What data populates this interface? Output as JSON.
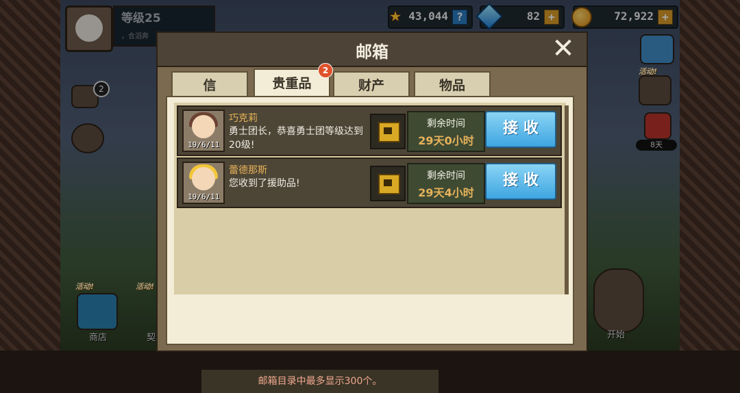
{
  "hud": {
    "level": "等级25",
    "level_sub": "，合滔奔",
    "resources": [
      {
        "icon": "star-medal-icon",
        "value": "43,044",
        "action": "?"
      },
      {
        "icon": "gem-icon",
        "value": "82",
        "action": "+"
      },
      {
        "icon": "coin-icon",
        "value": "72,922",
        "action": "+"
      }
    ]
  },
  "background": {
    "mail_badge": "2",
    "event_tag": "活动!",
    "shop_label": "商店",
    "start_label": "开始",
    "contract_label": "契约",
    "days": "8天"
  },
  "mailbox": {
    "title": "邮箱",
    "close": "✕",
    "tabs": [
      {
        "label": "信",
        "active": false
      },
      {
        "label": "贵重品",
        "active": true,
        "badge": "2"
      },
      {
        "label": "财产",
        "active": false
      },
      {
        "label": "物品",
        "active": false
      }
    ],
    "mails": [
      {
        "sender": "巧克莉",
        "body": "勇士团长，恭喜勇士团等级达到20级!",
        "date": "19/6/11",
        "time_label": "剩余时间",
        "time_value": "29天0小时",
        "button": "接 收"
      },
      {
        "sender": "蕾德那斯",
        "body": "您收到了援助品!",
        "date": "19/6/11",
        "time_label": "剩余时间",
        "time_value": "29天4小时",
        "button": "接 收"
      }
    ],
    "notice": "邮箱目录中最多显示300个。"
  }
}
